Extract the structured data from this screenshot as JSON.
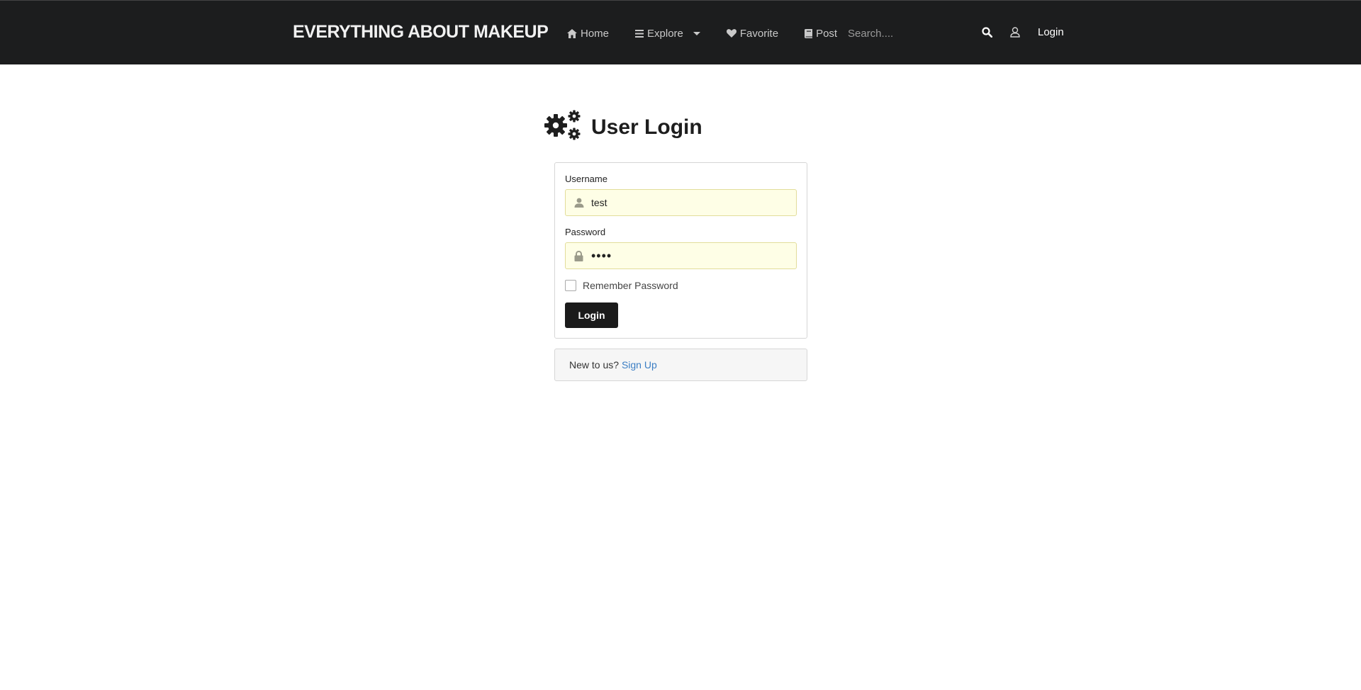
{
  "navbar": {
    "brand": "EVERYTHING ABOUT MAKEUP",
    "items": [
      {
        "label": "Home",
        "icon": "home-icon"
      },
      {
        "label": "Explore",
        "icon": "bars-icon",
        "has_dropdown": true
      },
      {
        "label": "Favorite",
        "icon": "heart-icon"
      },
      {
        "label": "Post",
        "icon": "book-icon"
      }
    ],
    "search_placeholder": "Search....",
    "login_label": "Login"
  },
  "page": {
    "title": "User Login",
    "title_icon": "gears-icon"
  },
  "login_form": {
    "username_label": "Username",
    "username_value": "test",
    "password_label": "Password",
    "password_value": "••••",
    "remember_label": "Remember Password",
    "remember_checked": false,
    "submit_label": "Login"
  },
  "signup": {
    "prompt": "New to us?",
    "link_label": "Sign Up"
  },
  "colors": {
    "navbar_bg": "#1c1d1e",
    "field_bg": "#fefee6",
    "button_bg": "#1b1b1b",
    "link": "#3b7ec4"
  }
}
